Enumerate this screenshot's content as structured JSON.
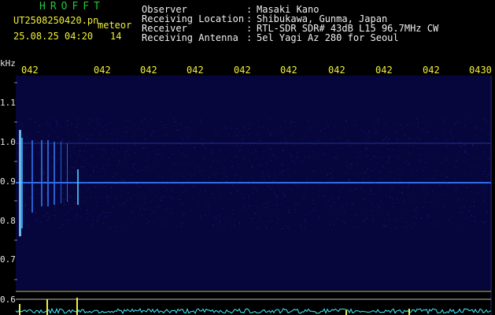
{
  "brand": "HROFFT",
  "file_name": "UT2508250420.pn",
  "meteor_label": "meteor",
  "timestamp": "25.08.25 04:20",
  "meteor_count": "14",
  "info": {
    "observer_label": "Observer",
    "observer": "Masaki Kano",
    "location_label": "Receiving Location",
    "location": "Shibukawa, Gunma, Japan",
    "receiver_label": "Receiver",
    "receiver": "RTL-SDR SDR# 43dB L15 96.7MHz CW",
    "antenna_label": "Receiving Antenna",
    "antenna": "5el Yagi Az 280 for Seoul",
    "separator": ":"
  },
  "time_ticks": [
    "042",
    "042",
    "042",
    "042",
    "042",
    "042",
    "042",
    "042",
    "042",
    "0430"
  ],
  "freq_unit": "kHz",
  "freq_ticks": [
    "1.1",
    "1.0",
    "0.9",
    "0.8",
    "0.7",
    "0.6"
  ],
  "colors": {
    "background": "#000000",
    "spectrogram_bg": "#06063c",
    "signal_line": "#2f6fe8",
    "signal_bright": "#7fd6ff",
    "header_yellow": "#f0ef3a",
    "header_green": "#25c43a",
    "baseline_cyan": "#3ff0ff",
    "baseline_yellow": "#f0ef3a"
  }
}
